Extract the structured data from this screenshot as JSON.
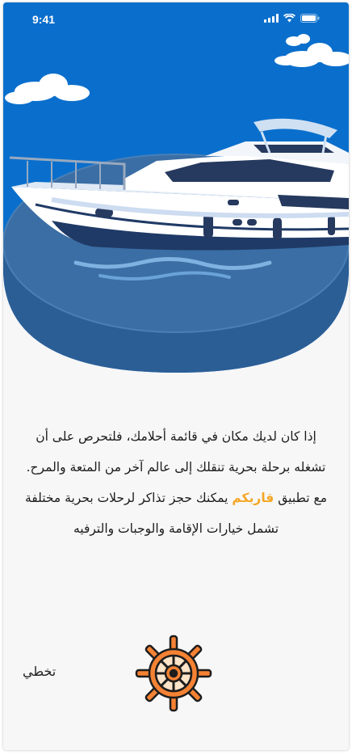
{
  "status_bar": {
    "time": "9:41"
  },
  "hero": {
    "icons": [
      "cloud-icon",
      "yacht-illustration",
      "island-disc"
    ],
    "colors": {
      "sky": "#0a6fcc",
      "sea": "#3a6ea5",
      "disc": "#2c5e96"
    }
  },
  "intro": {
    "line1": "إذا كان لديك مكان في قائمة أحلامك، فلتحرص على أن تشغله برحلة بحرية تنقلك إلى عالم آخر من المتعة والمرح.",
    "line2_prefix": "مع تطبيق ",
    "brand": "قاربكم",
    "line2_suffix": " يمكنك حجز تذاكر لرحلات بحرية مختلفة تشمل خيارات الإقامة والوجبات والترفيه"
  },
  "actions": {
    "skip_label": "تخطي"
  },
  "colors": {
    "accent": "#f5a623",
    "wheel_fill": "#f58233",
    "wheel_outline": "#1d1d1d"
  }
}
